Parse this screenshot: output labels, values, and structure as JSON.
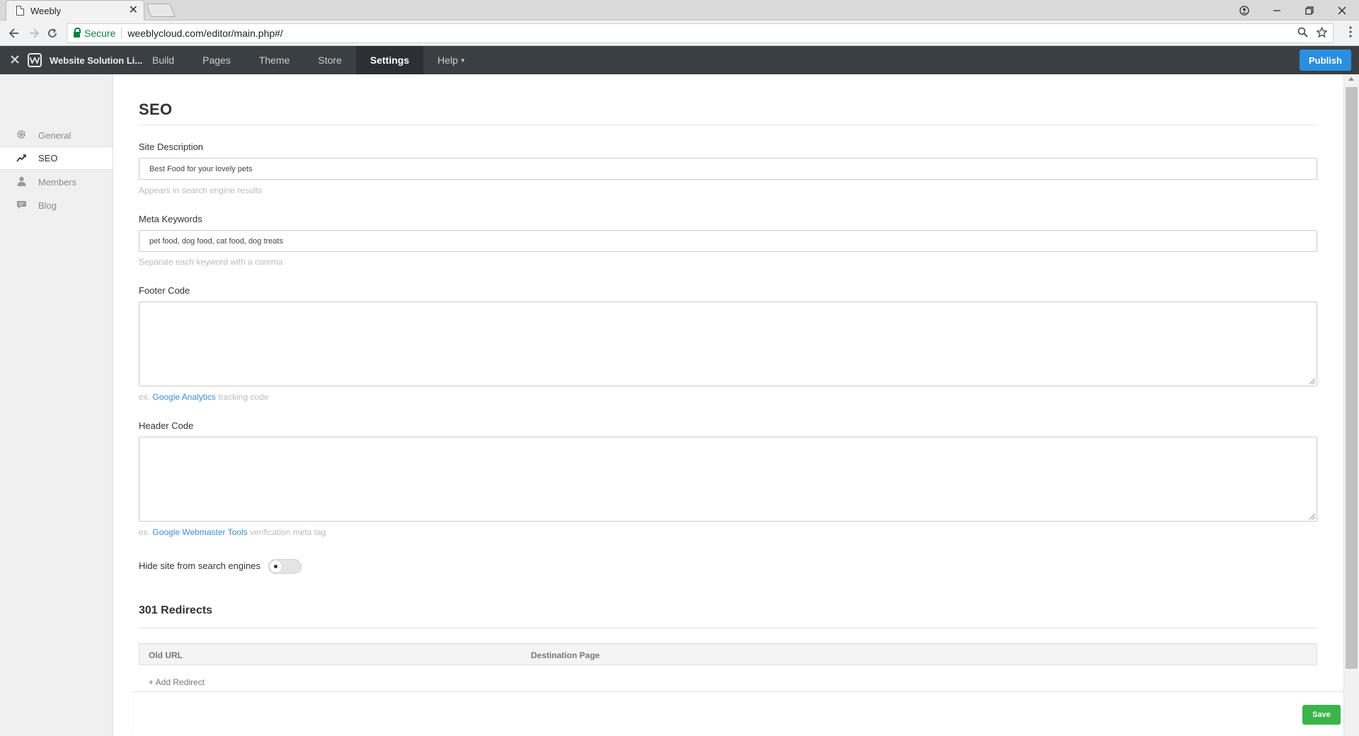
{
  "browser": {
    "tab_title": "Weebly",
    "tab_close": "✕",
    "secure_label": "Secure",
    "url": "weeblycloud.com/editor/main.php#/"
  },
  "toolbar": {
    "site_name": "Website Solution Li...",
    "nav": [
      {
        "label": "Build"
      },
      {
        "label": "Pages"
      },
      {
        "label": "Theme"
      },
      {
        "label": "Store"
      },
      {
        "label": "Settings"
      },
      {
        "label": "Help"
      }
    ],
    "publish_label": "Publish"
  },
  "sidebar": {
    "items": [
      {
        "label": "General",
        "icon": "gear-icon"
      },
      {
        "label": "SEO",
        "icon": "trend-icon"
      },
      {
        "label": "Members",
        "icon": "person-icon"
      },
      {
        "label": "Blog",
        "icon": "comment-icon"
      }
    ]
  },
  "main": {
    "title": "SEO",
    "site_description": {
      "label": "Site Description",
      "value": "Best Food for your lovely pets",
      "hint": "Appears in search engine results"
    },
    "meta_keywords": {
      "label": "Meta Keywords",
      "value": "pet food, dog food, cat food, dog treats",
      "hint": "Separate each keyword with a comma"
    },
    "footer_code": {
      "label": "Footer Code",
      "value": "",
      "hint_prefix": "ex.",
      "hint_link": "Google Analytics",
      "hint_suffix": "tracking code"
    },
    "header_code": {
      "label": "Header Code",
      "value": "",
      "hint_prefix": "ex.",
      "hint_link": "Google Webmaster Tools",
      "hint_suffix": "verification meta tag"
    },
    "hide_site": {
      "label": "Hide site from search engines",
      "enabled": false
    },
    "redirects": {
      "title": "301 Redirects",
      "columns": [
        "Old URL",
        "Destination Page"
      ],
      "add_label": "+ Add Redirect"
    }
  },
  "footer": {
    "save_label": "Save"
  },
  "colors": {
    "toolbar_bg": "#3a3f44",
    "publish": "#2a8fe0",
    "save": "#3bb54a",
    "link": "#3a8dd6",
    "secure": "#0b8043"
  }
}
